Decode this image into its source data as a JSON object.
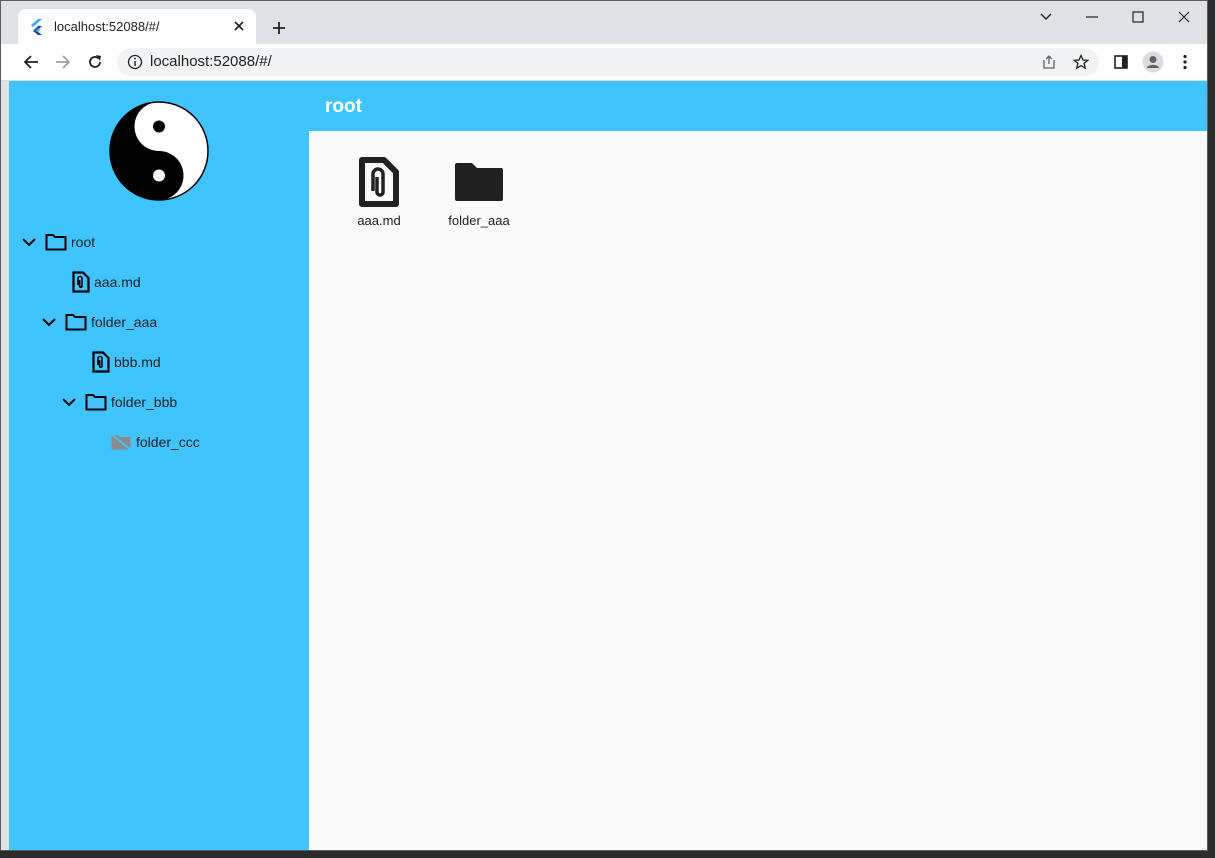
{
  "browser": {
    "tab": {
      "title": "localhost:52088/#/",
      "favicon": "flutter-icon"
    },
    "address_bar": {
      "url": "localhost:52088/#/"
    },
    "icons": [
      "back-icon",
      "forward-icon",
      "reload-icon",
      "info-icon",
      "share-icon",
      "star-icon",
      "sidebar-icon",
      "profile-icon",
      "menu-icon",
      "minimize-icon",
      "maximize-icon",
      "close-icon",
      "tab-search-icon",
      "new-tab-icon"
    ]
  },
  "sidebar": {
    "logo": "yin-yang-icon",
    "tree": [
      {
        "label": "root",
        "type": "folder",
        "expanded": true,
        "depth": 0
      },
      {
        "label": "aaa.md",
        "type": "file",
        "depth": 1
      },
      {
        "label": "folder_aaa",
        "type": "folder",
        "expanded": true,
        "depth": 1
      },
      {
        "label": "bbb.md",
        "type": "file",
        "depth": 2
      },
      {
        "label": "folder_bbb",
        "type": "folder",
        "expanded": true,
        "depth": 2
      },
      {
        "label": "folder_ccc",
        "type": "folder-off",
        "depth": 3
      }
    ]
  },
  "main": {
    "title": "root",
    "items": [
      {
        "label": "aaa.md",
        "icon": "file-attachment-icon"
      },
      {
        "label": "folder_aaa",
        "icon": "folder-icon"
      }
    ]
  },
  "colors": {
    "accent": "#40c4ff",
    "content_bg": "#fafafa",
    "chrome_bg": "#dee1e6"
  }
}
